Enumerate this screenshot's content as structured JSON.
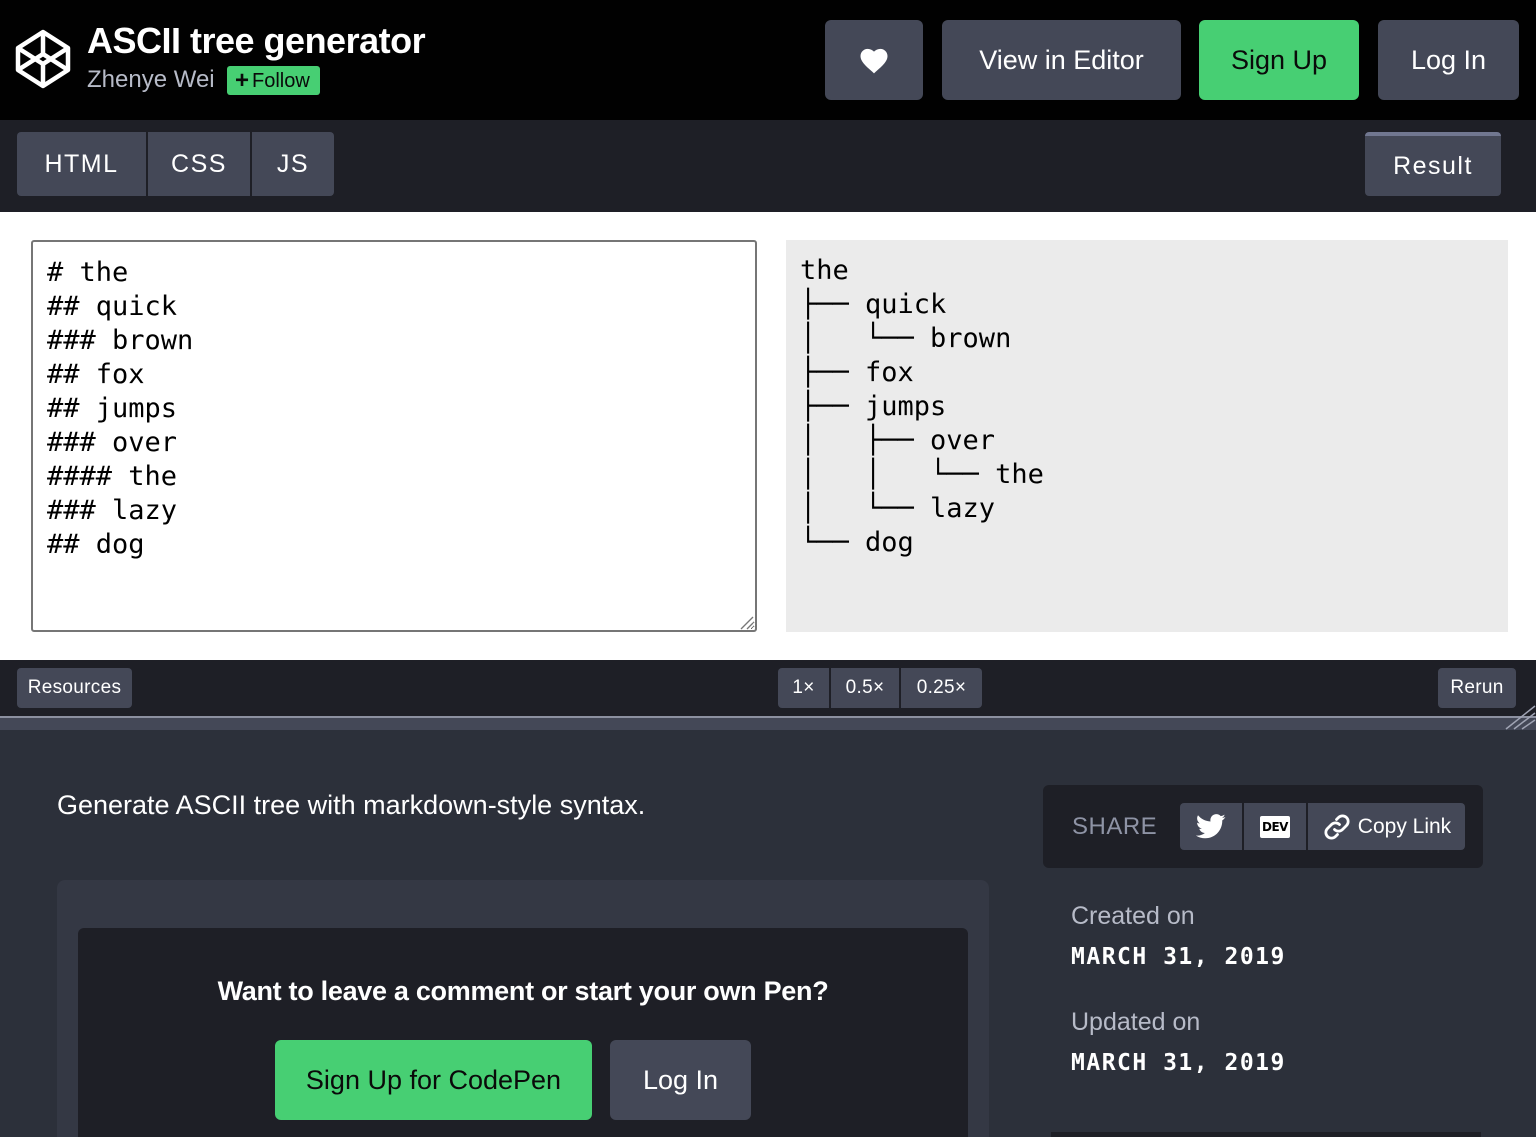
{
  "header": {
    "title": "ASCII tree generator",
    "author": "Zhenye Wei",
    "follow_label": "Follow",
    "view_in_editor": "View in Editor",
    "sign_up": "Sign Up",
    "log_in": "Log In"
  },
  "tabs": {
    "html": "HTML",
    "css": "CSS",
    "js": "JS",
    "result": "Result"
  },
  "result": {
    "input_text": "# the\n## quick\n### brown\n## fox\n## jumps\n### over\n#### the\n### lazy\n## dog",
    "output_text": "the\n├── quick\n│   └── brown\n├── fox\n├── jumps\n│   ├── over\n│   │   └── the\n│   └── lazy\n└── dog"
  },
  "toolbar": {
    "resources": "Resources",
    "zoom_options": [
      "1×",
      "0.5×",
      "0.25×"
    ],
    "rerun": "Rerun"
  },
  "details": {
    "description": "Generate ASCII tree with markdown-style syntax.",
    "cta_text": "Want to leave a comment or start your own Pen?",
    "cta_signup": "Sign Up for CodePen",
    "cta_login": "Log In",
    "share_label": "SHARE",
    "dev_label": "DEV",
    "copy_link": "Copy Link",
    "created_label": "Created on",
    "created_date": "MARCH 31, 2019",
    "updated_label": "Updated on",
    "updated_date": "MARCH 31, 2019"
  },
  "colors": {
    "green": "#47cf73",
    "button_gray": "#444857",
    "header_bg": "#010101",
    "panel_bg": "#2c303a"
  },
  "icons": [
    "codepen-logo-icon",
    "heart-icon",
    "twitter-icon",
    "dev-icon",
    "link-icon",
    "resize-grip-icon"
  ]
}
